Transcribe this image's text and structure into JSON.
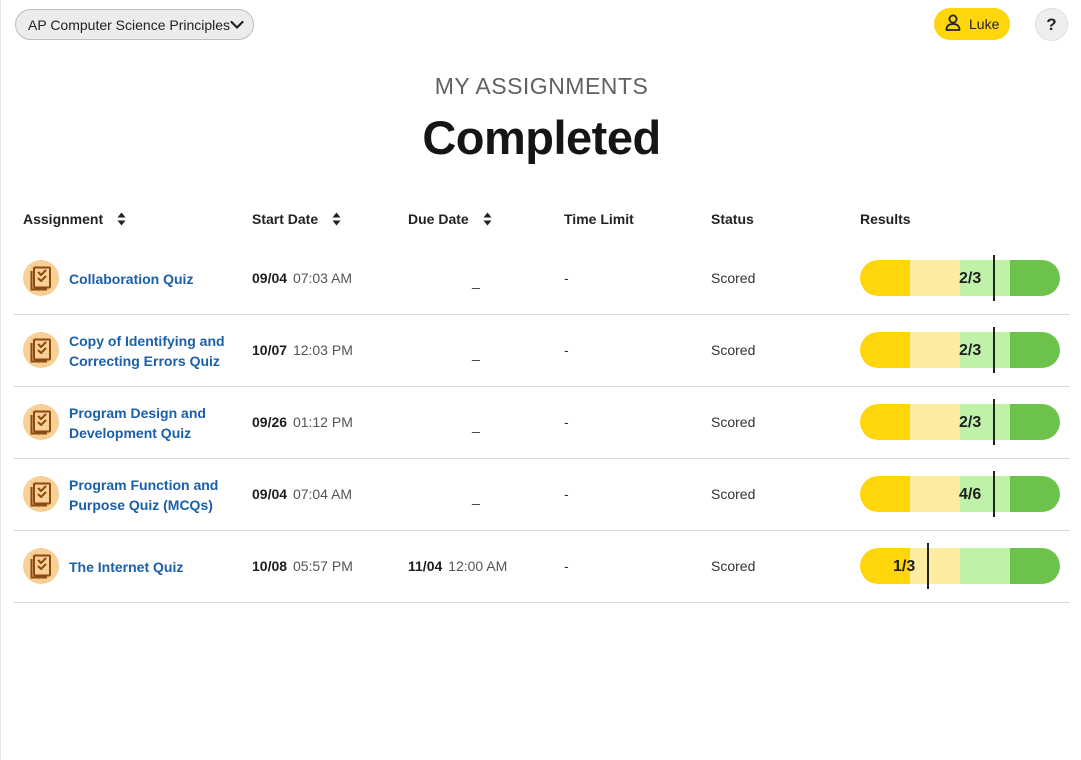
{
  "header": {
    "course_label": "AP Computer Science Principles",
    "user_name": "Luke",
    "help_label": "?"
  },
  "page": {
    "kicker": "MY ASSIGNMENTS",
    "title": "Completed"
  },
  "table": {
    "columns": {
      "assignment": "Assignment",
      "start_date": "Start Date",
      "due_date": "Due Date",
      "time_limit": "Time Limit",
      "status": "Status",
      "results": "Results"
    },
    "rows": [
      {
        "name": "Collaboration Quiz",
        "start_day": "09/04",
        "start_time": "07:03 AM",
        "due_day": "",
        "due_time": "",
        "due_placeholder": "_",
        "time_limit": "-",
        "status": "Scored",
        "score": "2/3",
        "score_fraction": 0.6667
      },
      {
        "name": "Copy of Identifying and Correcting Errors Quiz",
        "start_day": "10/07",
        "start_time": "12:03 PM",
        "due_day": "",
        "due_time": "",
        "due_placeholder": "_",
        "time_limit": "-",
        "status": "Scored",
        "score": "2/3",
        "score_fraction": 0.6667
      },
      {
        "name": "Program Design and Development Quiz",
        "start_day": "09/26",
        "start_time": "01:12 PM",
        "due_day": "",
        "due_time": "",
        "due_placeholder": "_",
        "time_limit": "-",
        "status": "Scored",
        "score": "2/3",
        "score_fraction": 0.6667
      },
      {
        "name": "Program Function and Purpose Quiz (MCQs)",
        "start_day": "09/04",
        "start_time": "07:04 AM",
        "due_day": "",
        "due_time": "",
        "due_placeholder": "_",
        "time_limit": "-",
        "status": "Scored",
        "score": "4/6",
        "score_fraction": 0.6667
      },
      {
        "name": "The Internet Quiz",
        "start_day": "10/08",
        "start_time": "05:57 PM",
        "due_day": "11/04",
        "due_time": "12:00 AM",
        "due_placeholder": "",
        "time_limit": "-",
        "status": "Scored",
        "score": "1/3",
        "score_fraction": 0.3333
      }
    ]
  },
  "colors": {
    "accent_yellow": "#ffd60a",
    "link_blue": "#1a5fa8",
    "band_1": "#ffd60a",
    "band_2": "#fdeba0",
    "band_3": "#bff2a8",
    "band_4": "#6cc24a",
    "icon_bg": "#f8cf95",
    "icon_fg": "#8a4a12"
  },
  "icons": {
    "course_dropdown": "chevron-down-icon",
    "user": "person-icon",
    "assignment": "clipboard-check-icon",
    "sort": "sort-arrows-icon"
  }
}
